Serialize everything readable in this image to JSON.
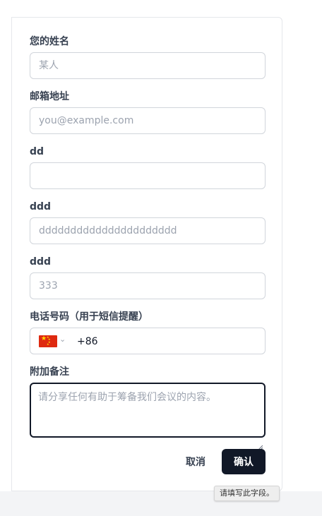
{
  "form": {
    "name": {
      "label": "您的姓名",
      "placeholder": "某人",
      "value": ""
    },
    "email": {
      "label": "邮箱地址",
      "placeholder": "you@example.com",
      "value": ""
    },
    "dd": {
      "label": "dd",
      "placeholder": "",
      "value": ""
    },
    "ddd1": {
      "label": "ddd",
      "placeholder": "dddddddddddddddddddddd",
      "value": ""
    },
    "ddd2": {
      "label": "ddd",
      "placeholder": "333",
      "value": ""
    },
    "phone": {
      "label": "电话号码（用于短信提醒）",
      "country_flag": "china-flag-icon",
      "dial_code": "+86",
      "value": "+86"
    },
    "notes": {
      "label": "附加备注",
      "placeholder": "请分享任何有助于筹备我们会议的内容。",
      "value": ""
    }
  },
  "actions": {
    "cancel_label": "取消",
    "confirm_label": "确认"
  },
  "validation_tooltip": "请填写此字段。",
  "colors": {
    "primary": "#111827",
    "border": "#d1d5db",
    "placeholder": "#9ca3af",
    "flag_red": "#de2910",
    "flag_yellow": "#ffde00"
  }
}
